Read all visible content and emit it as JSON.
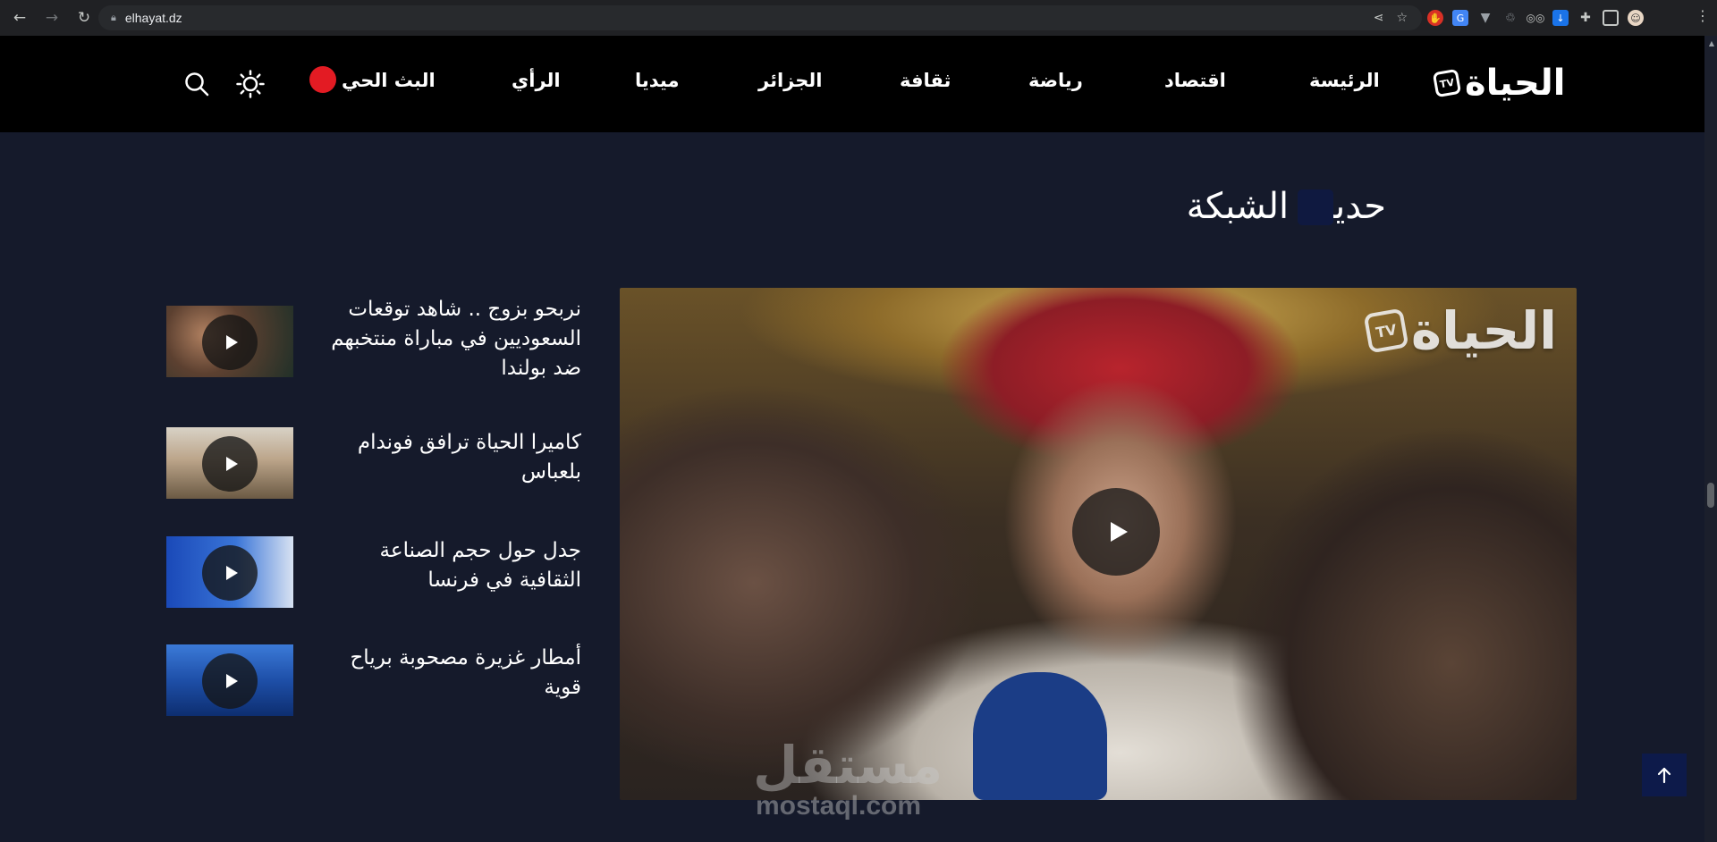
{
  "browser": {
    "url": "elhayat.dz"
  },
  "site": {
    "logo_text": "الحياة",
    "logo_badge": "TV",
    "nav": [
      "الرئيسة",
      "اقتصاد",
      "رياضة",
      "ثقافة",
      "الجزائر",
      "ميديا",
      "الرأي",
      "البث الحي"
    ]
  },
  "section": {
    "title": "حديث الشبكة"
  },
  "main_video": {
    "watermark_text": "الحياة",
    "watermark_badge": "TV"
  },
  "side_videos": [
    {
      "title": "نربحو بزوج .. شاهد توقعات السعوديين في مباراة منتخبهم ضد بولندا"
    },
    {
      "title": "كاميرا الحياة ترافق فوندام بلعباس"
    },
    {
      "title": "جدل حول حجم الصناعة الثقافية في فرنسا"
    },
    {
      "title": "أمطار غزيرة مصحوبة برياح قوية"
    }
  ],
  "watermark": {
    "ar": "مستقل",
    "en": "mostaql.com"
  },
  "colors": {
    "page_bg": "#151a2b",
    "header_bg": "#000000",
    "accent_red": "#e31b23",
    "marker": "#0f1940"
  },
  "icons": [
    "back-arrow-icon",
    "forward-arrow-icon",
    "reload-icon",
    "lock-icon",
    "share-icon",
    "star-icon",
    "sun-icon",
    "search-icon",
    "play-icon",
    "arrow-up-icon"
  ]
}
